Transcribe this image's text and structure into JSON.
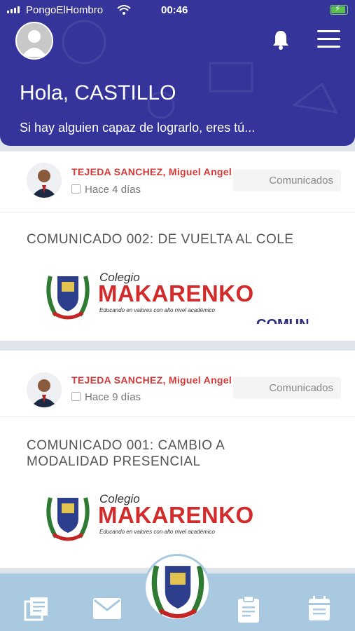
{
  "status_bar": {
    "carrier": "PongoElHombro",
    "time": "00:46"
  },
  "header": {
    "greeting": "Hola, CASTILLO",
    "motto": "Si hay alguien capaz de lograrlo, eres tú..."
  },
  "posts": [
    {
      "author": "TEJEDA SANCHEZ, Miguel Angel",
      "date": "Hace 4 días",
      "tag": "Comunicados",
      "title": "COMUNICADO 002: DE VUELTA AL COLE",
      "logo": {
        "colegio": "Colegio",
        "name": "MAKARENKO",
        "slogan": "Educando en valores con alto nivel académico"
      },
      "overflow_text": "COMUN"
    },
    {
      "author": "TEJEDA SANCHEZ, Miguel Angel",
      "date": "Hace 9 días",
      "tag": "Comunicados",
      "title_line1": "COMUNICADO 001: CAMBIO A",
      "title_line2": "MODALIDAD PRESENCIAL",
      "logo": {
        "colegio": "Colegio",
        "name": "MAKARENKO",
        "slogan": "Educando en valores con alto nivel académico"
      }
    }
  ],
  "colors": {
    "header": "#34349a",
    "accent_red": "#d23a3a",
    "bottom_bar": "#a9c9e0"
  },
  "bottom_nav": [
    "news-icon",
    "mail-icon",
    "school-crest",
    "clipboard-icon",
    "calendar-icon"
  ]
}
